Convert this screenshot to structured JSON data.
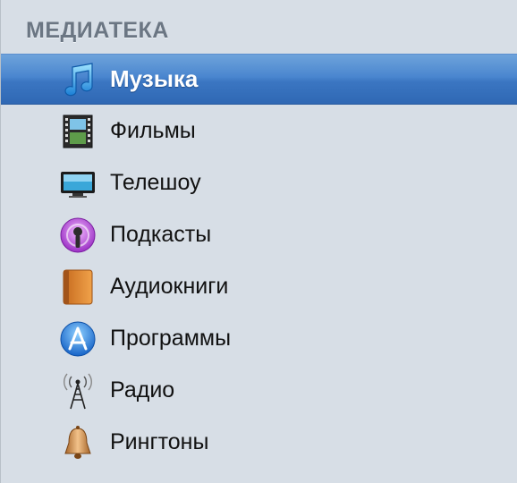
{
  "library": {
    "header": "МЕДИАТЕКА",
    "items": [
      {
        "label": "Музыка",
        "icon": "music-note-icon",
        "selected": true
      },
      {
        "label": "Фильмы",
        "icon": "film-icon",
        "selected": false
      },
      {
        "label": "Телешоу",
        "icon": "tv-icon",
        "selected": false
      },
      {
        "label": "Подкасты",
        "icon": "podcast-icon",
        "selected": false
      },
      {
        "label": "Аудиокниги",
        "icon": "audiobook-icon",
        "selected": false
      },
      {
        "label": "Программы",
        "icon": "app-store-icon",
        "selected": false
      },
      {
        "label": "Радио",
        "icon": "radio-antenna-icon",
        "selected": false
      },
      {
        "label": "Рингтоны",
        "icon": "bell-icon",
        "selected": false
      }
    ]
  },
  "colors": {
    "sidebar_bg": "#d7dee6",
    "selection": "#3b76c2",
    "header_text": "#6b7683"
  }
}
